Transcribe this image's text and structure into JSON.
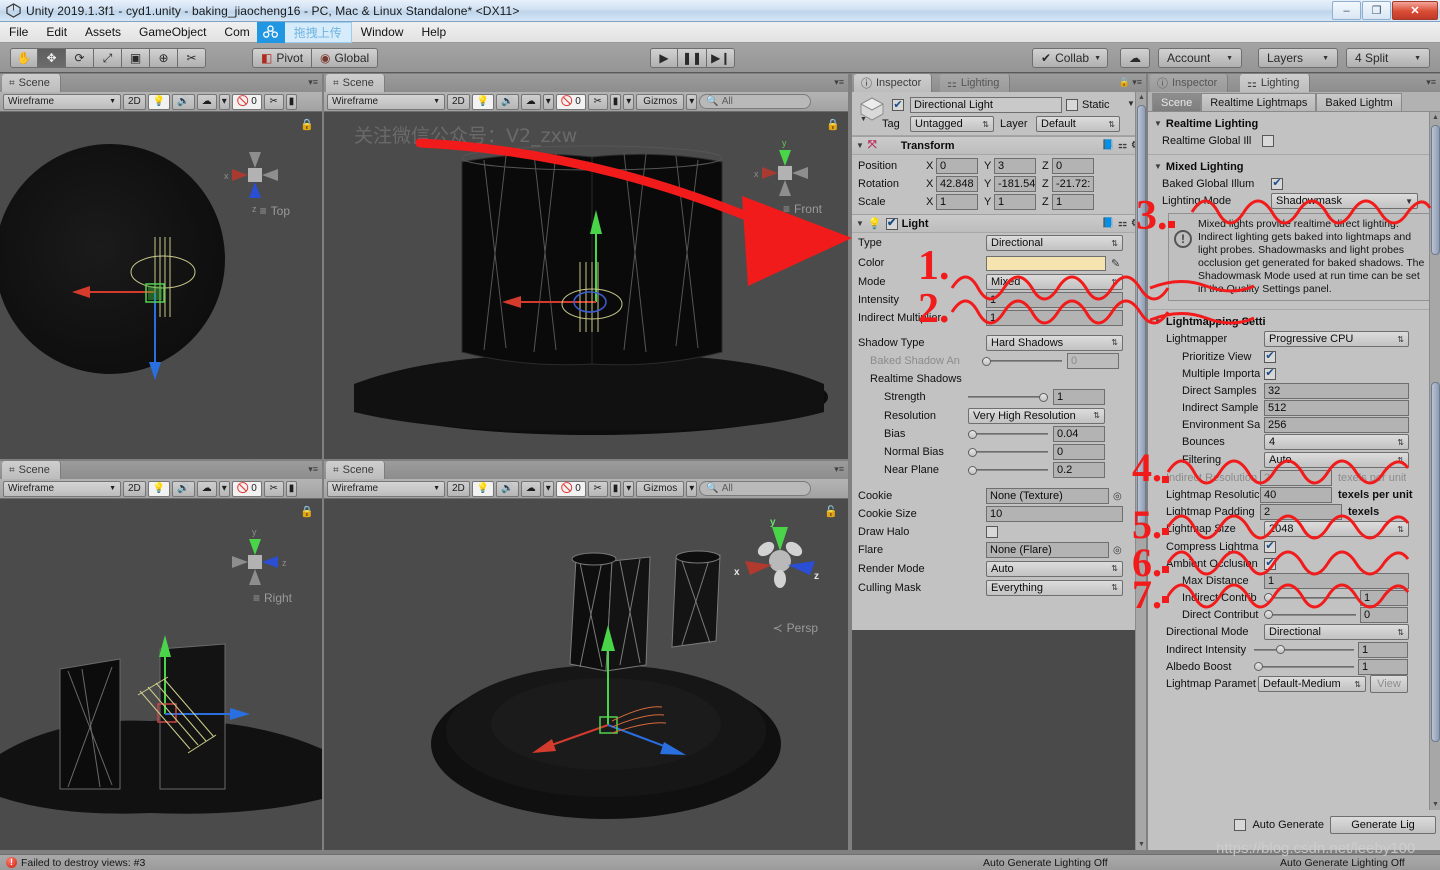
{
  "window": {
    "title": "Unity 2019.1.3f1 - cyd1.unity - baking_jiaocheng16 - PC, Mac & Linux Standalone* <DX11>",
    "app_icon": "unity-icon",
    "minimize": "–",
    "restore": "❐",
    "close": "✕"
  },
  "menubar": {
    "items": [
      "File",
      "Edit",
      "Assets",
      "GameObject",
      "Com"
    ],
    "upload_icon": "cloud-share-icon",
    "upload_label": "拖拽上传",
    "items_right": [
      "Window",
      "Help"
    ]
  },
  "toolbar": {
    "transform_tools": [
      {
        "name": "hand-tool",
        "glyph": "✋"
      },
      {
        "name": "move-tool",
        "glyph": "✥"
      },
      {
        "name": "rotate-tool",
        "glyph": "⟳"
      },
      {
        "name": "scale-tool",
        "glyph": "⤢"
      },
      {
        "name": "rect-tool",
        "glyph": "▣"
      },
      {
        "name": "transform-tool",
        "glyph": "⊕"
      },
      {
        "name": "custom-tool",
        "glyph": "✂"
      }
    ],
    "active_tool_index": 1,
    "pivot_label": "Pivot",
    "global_label": "Global",
    "play_glyph": "▶",
    "pause_glyph": "❚❚",
    "step_glyph": "▶❙",
    "collab_label": "Collab",
    "cloud_glyph": "☁",
    "account_label": "Account",
    "layers_label": "Layers",
    "layout_label": "4 Split"
  },
  "scene_views": [
    {
      "tab": "Scene",
      "draw_mode": "Wireframe",
      "two_d": "2D",
      "lighting_glyph": "💡",
      "audio_glyph": "🔊",
      "fx_glyph": "☁",
      "hidden_count": "0",
      "gizmo_label": "Top",
      "axis_labels": {
        "x": "x",
        "y": "",
        "z": "z"
      },
      "lock_glyph": "🔒"
    },
    {
      "tab": "Scene",
      "draw_mode": "Wireframe",
      "two_d": "2D",
      "hidden_count": "0",
      "gizmos_label": "Gizmos",
      "search_placeholder": "All",
      "gizmo_label": "Front",
      "axis_labels": {
        "x": "x",
        "y": "y",
        "z": ""
      },
      "watermark_cn": "关注微信公众号：V2_zxw",
      "lock_glyph": "🔒"
    },
    {
      "tab": "Scene",
      "draw_mode": "Wireframe",
      "two_d": "2D",
      "hidden_count": "0",
      "gizmo_label": "Right",
      "axis_labels": {
        "x": "",
        "y": "y",
        "z": "z"
      },
      "lock_glyph": "🔒"
    },
    {
      "tab": "Scene",
      "draw_mode": "Wireframe",
      "two_d": "2D",
      "hidden_count": "0",
      "gizmos_label": "Gizmos",
      "search_placeholder": "All",
      "gizmo_label": "Persp",
      "axis_labels": {
        "x": "x",
        "y": "y",
        "z": "z"
      },
      "lock_glyph": "🔓"
    }
  ],
  "inspector": {
    "tab_inspector": "Inspector",
    "tab_lighting": "Lighting",
    "object_name": "Directional Light",
    "object_enabled": true,
    "static_label": "Static",
    "static_checked": false,
    "tag_label": "Tag",
    "tag_value": "Untagged",
    "layer_label": "Layer",
    "layer_value": "Default",
    "transform": {
      "title": "Transform",
      "rows": [
        {
          "label": "Position",
          "x": "0",
          "y": "3",
          "z": "0"
        },
        {
          "label": "Rotation",
          "x": "42.848",
          "y": "-181.54",
          "z": "-21.72:"
        },
        {
          "label": "Scale",
          "x": "1",
          "y": "1",
          "z": "1"
        }
      ]
    },
    "light": {
      "title": "Light",
      "enabled": true,
      "type_label": "Type",
      "type_value": "Directional",
      "color_label": "Color",
      "color_value": "#F5E3B0",
      "eyedropper": "eyedropper-icon",
      "mode_label": "Mode",
      "mode_value": "Mixed",
      "intensity_label": "Intensity",
      "intensity_value": "1",
      "indirect_mult_label": "Indirect Multiplier",
      "indirect_mult_value": "1",
      "shadow_type_label": "Shadow Type",
      "shadow_type_value": "Hard Shadows",
      "baked_shadow_angle_label": "Baked Shadow An",
      "baked_shadow_angle_value": "0",
      "realtime_shadows_label": "Realtime Shadows",
      "strength_label": "Strength",
      "strength_value": "1",
      "resolution_label": "Resolution",
      "resolution_value": "Very High Resolution",
      "bias_label": "Bias",
      "bias_value": "0.04",
      "normal_bias_label": "Normal Bias",
      "normal_bias_value": "0",
      "near_plane_label": "Near Plane",
      "near_plane_value": "0.2",
      "cookie_label": "Cookie",
      "cookie_value": "None (Texture)",
      "cookie_size_label": "Cookie Size",
      "cookie_size_value": "10",
      "draw_halo_label": "Draw Halo",
      "draw_halo_checked": false,
      "flare_label": "Flare",
      "flare_value": "None (Flare)",
      "render_mode_label": "Render Mode",
      "render_mode_value": "Auto",
      "culling_mask_label": "Culling Mask",
      "culling_mask_value": "Everything"
    }
  },
  "lighting": {
    "tab_inspector": "Inspector",
    "tab_lighting": "Lighting",
    "tabs": [
      "Scene",
      "Realtime Lightmaps",
      "Baked Lightm"
    ],
    "selected_tab": "Scene",
    "realtime_lighting": {
      "title": "Realtime Lighting",
      "rtgi_label": "Realtime Global Ill",
      "rtgi_checked": false
    },
    "mixed_lighting": {
      "title": "Mixed Lighting",
      "baked_gi_label": "Baked Global Illum",
      "baked_gi_checked": true,
      "lighting_mode_label": "Lighting Mode",
      "lighting_mode_value": "Shadowmask",
      "help_icon": "info-icon",
      "help_text": "Mixed lights provide realtime direct lighting. Indirect lighting gets baked into lightmaps and light probes. Shadowmasks and light probes occlusion get generated for baked shadows. The Shadowmask Mode used at run time can be set in the Quality Settings panel."
    },
    "lightmapping": {
      "title": "Lightmapping Setti",
      "lightmapper_label": "Lightmapper",
      "lightmapper_value": "Progressive CPU",
      "prioritize_view_label": "Prioritize View",
      "prioritize_view_checked": true,
      "multiple_imp_label": "Multiple Importa",
      "multiple_imp_checked": true,
      "direct_samples_label": "Direct Samples",
      "direct_samples_value": "32",
      "indirect_samples_label": "Indirect Sample",
      "indirect_samples_value": "512",
      "environment_samples_label": "Environment Sa",
      "environment_samples_value": "256",
      "bounces_label": "Bounces",
      "bounces_value": "4",
      "filtering_label": "Filtering",
      "filtering_value": "Auto",
      "indirect_res_label": "Indirect Resolution",
      "indirect_res_value": "2",
      "indirect_res_unit": "texels per unit",
      "lightmap_res_label": "Lightmap Resolutic",
      "lightmap_res_value": "40",
      "lightmap_res_unit": "texels per unit",
      "lightmap_padding_label": "Lightmap Padding",
      "lightmap_padding_value": "2",
      "lightmap_padding_unit": "texels",
      "lightmap_size_label": "Lightmap Size",
      "lightmap_size_value": "2048",
      "compress_label": "Compress Lightma",
      "compress_checked": true,
      "ao_label": "Ambient Occlusion",
      "ao_checked": true,
      "max_distance_label": "Max Distance",
      "max_distance_value": "1",
      "indirect_contrib_label": "Indirect Contrib",
      "indirect_contrib_value": "1",
      "direct_contrib_label": "Direct Contribut",
      "direct_contrib_value": "0",
      "directional_mode_label": "Directional Mode",
      "directional_mode_value": "Directional",
      "indirect_intensity_label": "Indirect Intensity",
      "indirect_intensity_value": "1",
      "albedo_boost_label": "Albedo Boost",
      "albedo_boost_value": "1",
      "lightmap_param_label": "Lightmap Paramet",
      "lightmap_param_value": "Default-Medium",
      "view_button": "View"
    },
    "footer": {
      "auto_generate_label": "Auto Generate",
      "auto_generate_checked": false,
      "generate_button": "Generate Lig"
    }
  },
  "status": {
    "error_icon": "error-icon",
    "error_text": "Failed to destroy views: #3",
    "auto_lighting_center": "Auto Generate Lighting Off",
    "auto_lighting_right": "Auto Generate Lighting Off",
    "watermark_url": "https://blog.csdn.net/leeby100"
  },
  "annotations": {
    "color": "#F21B1B",
    "numbers": [
      "1.",
      "2.",
      "3.",
      "4.",
      "5.",
      "6.",
      "7."
    ]
  }
}
